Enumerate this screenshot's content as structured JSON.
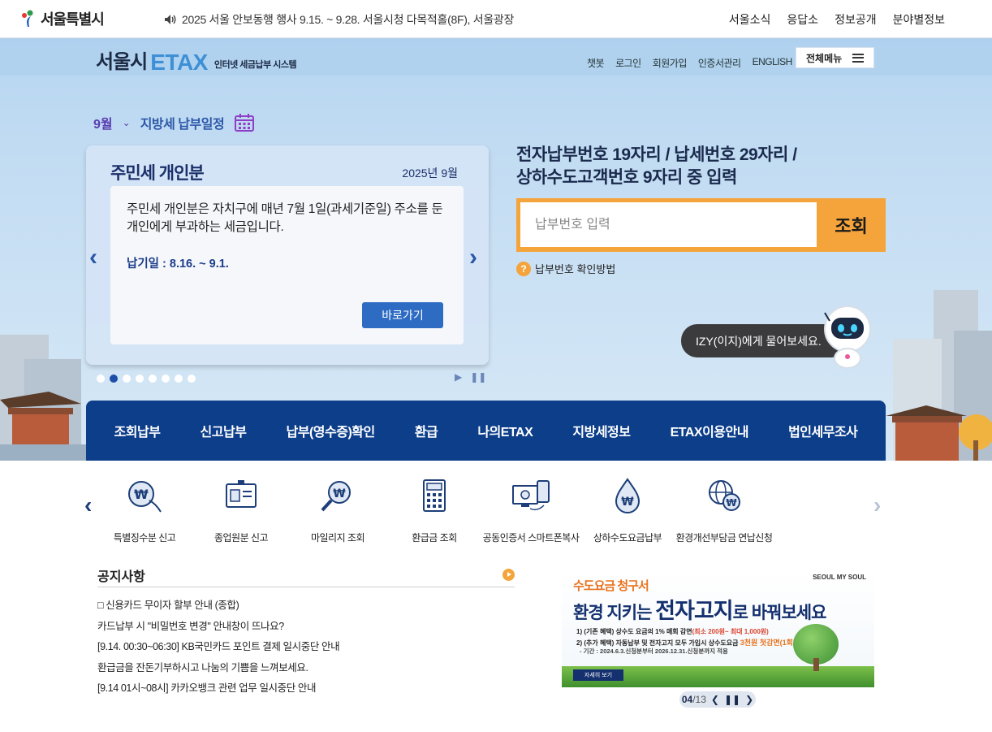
{
  "gov": {
    "logo_text": "서울특별시",
    "notice": "2025 서울 안보동행 행사 9.15. ~ 9.28. 서울시청 다목적홀(8F), 서울광장",
    "nav": [
      "서울소식",
      "응답소",
      "정보공개",
      "분야별정보"
    ]
  },
  "etax": {
    "logo_a": "서울시",
    "logo_b": "ETAX",
    "logo_c": "인터넷 세금납부 시스템",
    "util_nav": [
      "챗봇",
      "로그인",
      "회원가입",
      "인증서관리",
      "ENGLISH"
    ],
    "all_menu": "전체메뉴"
  },
  "schedule": {
    "month": "9월",
    "title": "지방세 납부일정"
  },
  "tax_card": {
    "title": "주민세 개인분",
    "date": "2025년 9월",
    "desc": "주민세 개인분은 자치구에 매년 7월 1일(과세기준일) 주소를 둔 개인에게 부과하는 세금입니다.",
    "due": "납기일 : 8.16. ~ 9.1.",
    "go_label": "바로가기"
  },
  "carousel": {
    "total_dots": 8,
    "active_dot": 1
  },
  "search": {
    "title_line1": "전자납부번호 19자리 / 납세번호 29자리 /",
    "title_line2": "상하수도고객번호 9자리 중 입력",
    "placeholder": "납부번호 입력",
    "button": "조회",
    "help": "납부번호 확인방법"
  },
  "izy": {
    "text": "IZY(이지)에게 물어보세요."
  },
  "main_menu": [
    "조회납부",
    "신고납부",
    "납부(영수증)확인",
    "환급",
    "나의ETAX",
    "지방세정보",
    "ETAX이용안내",
    "법인세무조사"
  ],
  "quick": [
    {
      "label": "특별징수분 신고",
      "icon": "hand-coin-icon"
    },
    {
      "label": "종업원분 신고",
      "icon": "id-card-icon"
    },
    {
      "label": "마일리지 조회",
      "icon": "magnifier-coin-icon"
    },
    {
      "label": "환급금 조회",
      "icon": "calculator-icon"
    },
    {
      "label": "공동인증서 스마트폰복사",
      "icon": "device-copy-icon"
    },
    {
      "label": "상하수도요금납부",
      "icon": "water-drop-icon"
    },
    {
      "label": "환경개선부담금 연납신청",
      "icon": "globe-coin-icon"
    }
  ],
  "notice": {
    "title": "공지사항",
    "items": [
      "□ 신용카드 무이자 할부 안내 (종합)",
      "카드납부 시 \"비밀번호 변경\" 안내창이 뜨나요?",
      "[9.14. 00:30~06:30] KB국민카드 포인트 결제 일시중단 안내",
      "환급금을 잔돈기부하시고 나눔의 기쁨을 느껴보세요.",
      "[9.14 01시~08시] 카카오뱅크 관련 업무 일시중단 안내"
    ]
  },
  "banner": {
    "t1": "수도요금 청구서",
    "t2a": "환경 지키는 ",
    "t2b": "전자고지",
    "t2c": "로 바꿔보세요",
    "brand": "SEOUL MY SOUL",
    "l1a": "1) (기존 혜택) 상수도 요금의 1% 매회 감면",
    "l1b": "(최소 200원~ 최대 1,000원)",
    "l2a": "2) (추가 혜택) 자동납부 및 전자고지 모두 가입시 상수도요금 ",
    "l2b": "3천원 첫감면(1회)",
    "l3": "- 기간 : 2024.6.3.신청분부터 2026.12.31.신청분까지 적용",
    "detail": "자세히 보기"
  },
  "pager": {
    "current": "04",
    "total": "/13"
  },
  "colors": {
    "accent": "#f4a43b",
    "navy": "#0d3e8a",
    "brand_blue": "#3d8fd6"
  }
}
